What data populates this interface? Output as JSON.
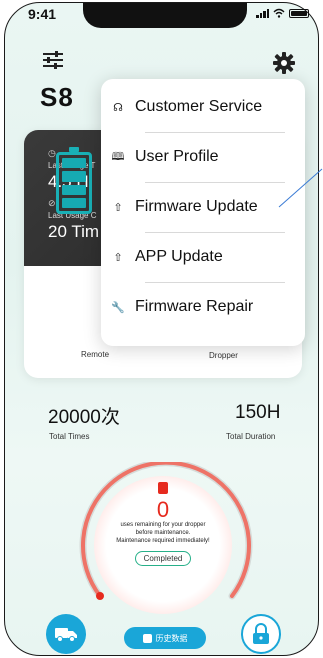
{
  "status_bar": {
    "time": "9:41"
  },
  "header": {
    "brand": "S8"
  },
  "card": {
    "last_usage_time_label": "Last Usage T",
    "last_usage_time_value": "4.5 H",
    "last_usage_count_label": "Last Usage C",
    "last_usage_count_value": "20 Tim",
    "remote_label": "Remote",
    "dropper_label": "Dropper"
  },
  "stats": {
    "total_times_value": "20000次",
    "total_times_label": "Total Times",
    "total_duration_value": "150H",
    "total_duration_label": "Total Duration"
  },
  "gauge": {
    "remaining": "0",
    "line1": "uses remaining for your dropper",
    "line2": "before maintenance.",
    "line3": "Maintenance required immediately!",
    "status_button": "Completed"
  },
  "bottom_bar": {
    "history_label": "历史数据"
  },
  "menu": {
    "items": [
      {
        "label": "Customer Service",
        "icon": "headset-icon"
      },
      {
        "label": "User Profile",
        "icon": "book-icon"
      },
      {
        "label": "Firmware Update",
        "icon": "cloud-upload-icon"
      },
      {
        "label": "APP Update",
        "icon": "cloud-upload-icon"
      },
      {
        "label": "Firmware Repair",
        "icon": "wrench-icon"
      }
    ]
  },
  "colors": {
    "accent": "#1aa6d8",
    "teal": "#19b0b6",
    "alert": "#e62a1e",
    "success": "#27b089",
    "dark_panel": "#333333"
  }
}
